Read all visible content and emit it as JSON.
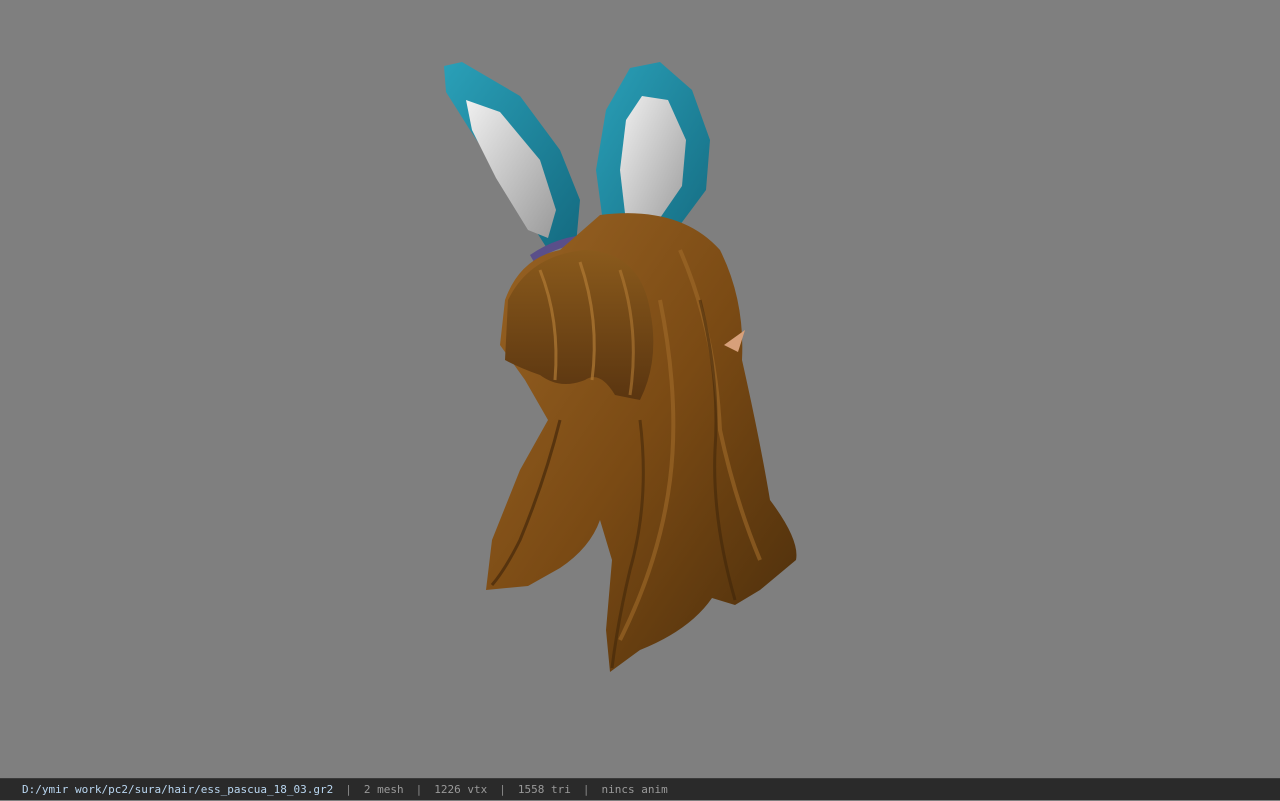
{
  "viewer": {
    "background_color": "#7f7f7f",
    "model_name": "bunny-ear hair model",
    "colors": {
      "hair_light": "#8a5a1c",
      "hair_dark": "#4a2d0b",
      "ear_outer": "#1f8fa8",
      "ear_inner": "#d8d8d8",
      "headband": "#5a4f8a",
      "skin": "#d7a07a"
    }
  },
  "statusbar": {
    "file_path": "D:/ymir work/pc2/sura/hair/ess_pascua_18_03.gr2",
    "separator": "|",
    "mesh": "2 mesh",
    "vertices": "1226 vtx",
    "triangles": "1558 tri",
    "anim": "nincs anim"
  }
}
